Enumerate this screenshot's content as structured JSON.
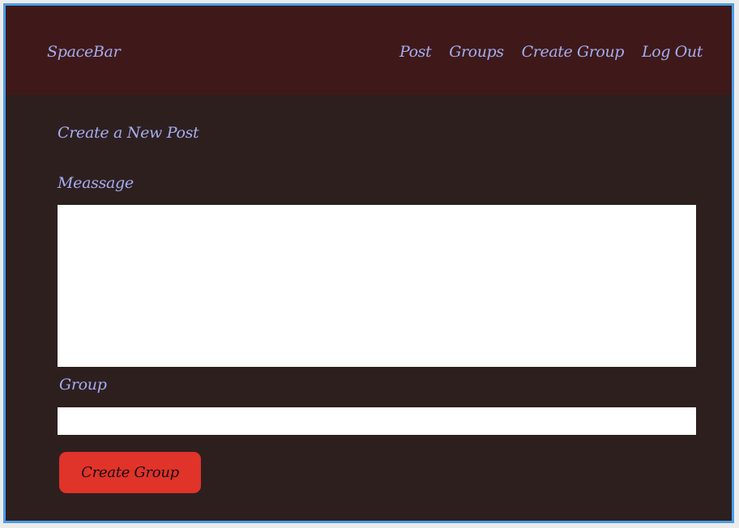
{
  "navbar": {
    "brand": "SpaceBar",
    "links": [
      {
        "label": "Post"
      },
      {
        "label": "Groups"
      },
      {
        "label": "Create Group"
      },
      {
        "label": "Log Out"
      }
    ]
  },
  "form": {
    "title": "Create a New Post",
    "message_label": "Meassage",
    "message_value": "",
    "group_label": "Group",
    "group_value": "",
    "submit_label": "Create Group"
  },
  "colors": {
    "frame_border": "#4a9ee8",
    "navbar_bg": "#3f1919",
    "page_bg": "#2e1f1f",
    "text_accent": "#a4aef0",
    "button_bg": "#e0332a"
  }
}
